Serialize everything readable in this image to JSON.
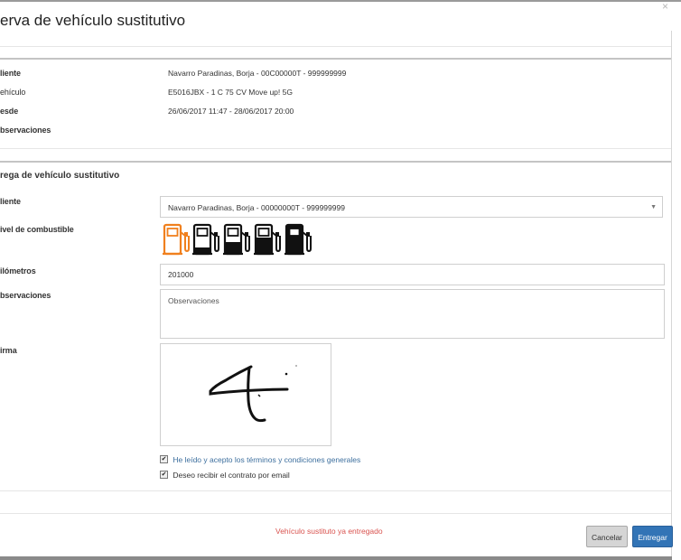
{
  "modal": {
    "title": "erva de vehículo sustitutivo",
    "close_glyph": "×"
  },
  "summary": {
    "rows": [
      {
        "label": "liente",
        "value": "Navarro Paradinas, Borja - 00C00000T - 999999999"
      },
      {
        "label": "ehículo",
        "value": "E5016JBX - 1 C 75 CV Move up! 5G"
      },
      {
        "label": "esde",
        "value": "26/06/2017 11:47 - 28/06/2017 20:00"
      },
      {
        "label": "bservaciones",
        "value": ""
      }
    ]
  },
  "delivery": {
    "section_title": "rega de vehículo sustitutivo",
    "client_label": "liente",
    "client_selected": "Navarro Paradinas, Borja - 00000000T - 999999999",
    "fuel_label": "ivel de combustible",
    "fuel_levels": [
      "empty",
      "quarter",
      "half",
      "three-quarter",
      "full"
    ],
    "fuel_selected_index": 0,
    "fuel_active_color": "#f0801e",
    "km_label": "ilómetros",
    "km_value": "201000",
    "obs_label": "bservaciones",
    "obs_placeholder": "Observaciones",
    "signature_label": "irma",
    "terms_text": "He leído y acepto los términos y condiciones generales",
    "email_text": "Deseo recibir el contrato por email"
  },
  "footer": {
    "status_message": "Vehículo sustituto ya entregado",
    "cancel_label": "Cancelar",
    "submit_label": "Entregar"
  }
}
